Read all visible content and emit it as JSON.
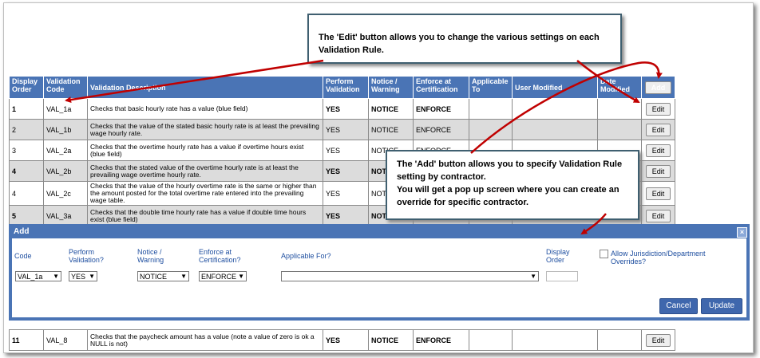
{
  "table": {
    "headers": {
      "display_order": "Display Order",
      "validation_code": "Validation Code",
      "validation_description": "Validation Description",
      "perform_validation": "Perform Validation",
      "notice_warning": "Notice / Warning",
      "enforce_at_certification": "Enforce at Certification",
      "applicable_to": "Applicable To",
      "user_modified": "User Modified",
      "date_modified": "Date Modified"
    },
    "add_label": "Add",
    "edit_label": "Edit",
    "rows": [
      {
        "order": "1",
        "code": "VAL_1a",
        "description": "Checks that basic hourly rate has a value (blue field)",
        "perform": "YES",
        "notice": "NOTICE",
        "enforce": "ENFORCE"
      },
      {
        "order": "2",
        "code": "VAL_1b",
        "description": "Checks that the value of the stated basic hourly rate is at least the prevailing wage hourly rate.",
        "perform": "YES",
        "notice": "NOTICE",
        "enforce": "ENFORCE"
      },
      {
        "order": "3",
        "code": "VAL_2a",
        "description": "Checks that the overtime hourly rate has a value if overtime hours exist (blue field)",
        "perform": "YES",
        "notice": "NOTICE",
        "enforce": "ENFORCE"
      },
      {
        "order": "4",
        "code": "VAL_2b",
        "description": "Checks that the stated value of the overtime hourly rate is at least the prevailing wage overtime hourly rate.",
        "perform": "YES",
        "notice": "NOT",
        "enforce": ""
      },
      {
        "order": "4",
        "code": "VAL_2c",
        "description": "Checks that the value of the hourly overtime rate is the same or higher than the amount posted for the total overtime rate entered into the prevailing wage table.",
        "perform": "YES",
        "notice": "NOT",
        "enforce": ""
      },
      {
        "order": "5",
        "code": "VAL_3a",
        "description": "Checks that the double time hourly rate has a value if double time hours exist (blue field)",
        "perform": "YES",
        "notice": "NOT",
        "enforce": ""
      }
    ],
    "last_row": {
      "order": "11",
      "code": "VAL_8",
      "description": "Checks that the paycheck amount has a value (note a value of zero is ok a NULL is not)",
      "perform": "YES",
      "notice": "NOTICE",
      "enforce": "ENFORCE"
    }
  },
  "callouts": {
    "edit": "The 'Edit' button allows you to change the various settings on each Validation Rule.",
    "add_line1": "The 'Add' button allows you to specify Validation Rule setting by contractor.",
    "add_line2": "You will get a pop up screen where you can create an override for specific contractor."
  },
  "dialog": {
    "title": "Add",
    "close": "×",
    "labels": {
      "code": "Code",
      "perform": "Perform Validation?",
      "notice": "Notice / Warning",
      "enforce": "Enforce at Certification?",
      "applicable": "Applicable For?",
      "display_order": "Display Order",
      "allow_override": "Allow Jurisdiction/Department Overrides?"
    },
    "values": {
      "code": "VAL_1a",
      "perform": "YES",
      "notice": "NOTICE",
      "enforce": "ENFORCE",
      "applicable": "",
      "display_order": ""
    },
    "cancel": "Cancel",
    "update": "Update"
  },
  "colors": {
    "header_blue": "#4a74b5",
    "row_alt_gray": "#dcdcdc",
    "arrow_red": "#c00000",
    "callout_border": "#3f5f70"
  },
  "icons": {
    "dropdown": "chevron-down-icon",
    "close": "close-icon"
  }
}
